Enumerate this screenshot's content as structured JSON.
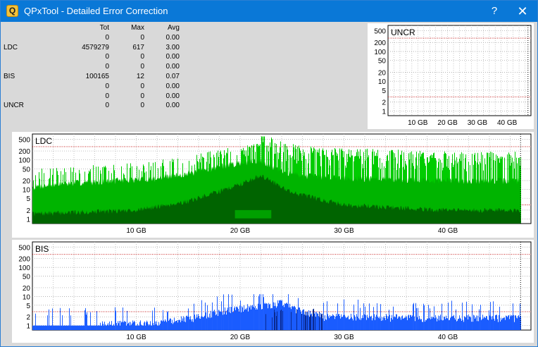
{
  "window": {
    "title": "QPxTool - Detailed Error Correction",
    "icon_letter": "Q",
    "help_glyph": "?",
    "close_glyph": "✕"
  },
  "stats": {
    "headers": {
      "tot": "Tot",
      "max": "Max",
      "avg": "Avg"
    },
    "rows": [
      {
        "label": "",
        "tot": "0",
        "max": "0",
        "avg": "0.00"
      },
      {
        "label": "LDC",
        "tot": "4579279",
        "max": "617",
        "avg": "3.00"
      },
      {
        "label": "",
        "tot": "0",
        "max": "0",
        "avg": "0.00"
      },
      {
        "label": "",
        "tot": "0",
        "max": "0",
        "avg": "0.00"
      },
      {
        "label": "BIS",
        "tot": "100165",
        "max": "12",
        "avg": "0.07"
      },
      {
        "label": "",
        "tot": "0",
        "max": "0",
        "avg": "0.00"
      },
      {
        "label": "",
        "tot": "0",
        "max": "0",
        "avg": "0.00"
      },
      {
        "label": "UNCR",
        "tot": "0",
        "max": "0",
        "avg": "0.00"
      }
    ]
  },
  "chart_data": [
    {
      "id": "uncr",
      "type": "area",
      "title": "UNCR",
      "scale": "log",
      "y_ticks": [
        1,
        2,
        5,
        10,
        20,
        50,
        100,
        200,
        500
      ],
      "x_ticks": [
        "10 GB",
        "20 GB",
        "30 GB",
        "40 GB"
      ],
      "x_tick_values": [
        10,
        20,
        30,
        40
      ],
      "xlim": [
        0,
        48
      ],
      "disc_end_gb": 47,
      "threshold_levels": [
        280,
        3
      ],
      "grid": true,
      "series": [
        {
          "values": [
            0
          ]
        }
      ]
    },
    {
      "id": "ldc",
      "type": "area",
      "title": "LDC",
      "scale": "log",
      "y_ticks": [
        1,
        2,
        5,
        10,
        20,
        50,
        100,
        200,
        500
      ],
      "x_ticks": [
        "10 GB",
        "20 GB",
        "30 GB",
        "40 GB"
      ],
      "x_tick_values": [
        10,
        20,
        30,
        40
      ],
      "xlim": [
        0,
        48
      ],
      "disc_end_gb": 47,
      "threshold_levels": [
        280,
        3
      ],
      "grid": true,
      "colors": {
        "spike": "#00cc00",
        "envelope": "#00b400",
        "base": "#006400",
        "mid": "#00a000"
      },
      "envelope": {
        "x": [
          0,
          3,
          8,
          12,
          16,
          18,
          20,
          22,
          24,
          26,
          30,
          36,
          40,
          44,
          47
        ],
        "y": [
          12,
          16,
          20,
          24,
          40,
          60,
          80,
          100,
          40,
          30,
          25,
          22,
          20,
          20,
          20
        ]
      },
      "base": {
        "x": [
          0,
          10,
          15,
          20,
          22,
          25,
          30,
          40,
          47
        ],
        "y": [
          1.5,
          2,
          4,
          15,
          30,
          8,
          3,
          2,
          2
        ]
      },
      "max": 617
    },
    {
      "id": "bis",
      "type": "area",
      "title": "BIS",
      "scale": "log",
      "y_ticks": [
        1,
        2,
        5,
        10,
        20,
        50,
        100,
        200,
        500
      ],
      "x_ticks": [
        "10 GB",
        "20 GB",
        "30 GB",
        "40 GB"
      ],
      "x_tick_values": [
        10,
        20,
        30,
        40
      ],
      "xlim": [
        0,
        48
      ],
      "disc_end_gb": 47,
      "threshold_levels": [
        280,
        3
      ],
      "grid": true,
      "colors": {
        "fill": "#1a5cff",
        "spike": "#1f5fff",
        "dark": "#0a2a90"
      },
      "envelope": {
        "x": [
          0,
          12,
          16,
          18,
          20,
          22,
          24,
          26,
          28,
          47
        ],
        "y": [
          1,
          1.2,
          2,
          3,
          4,
          5,
          6,
          3,
          2,
          1.8
        ]
      },
      "max": 12
    }
  ]
}
